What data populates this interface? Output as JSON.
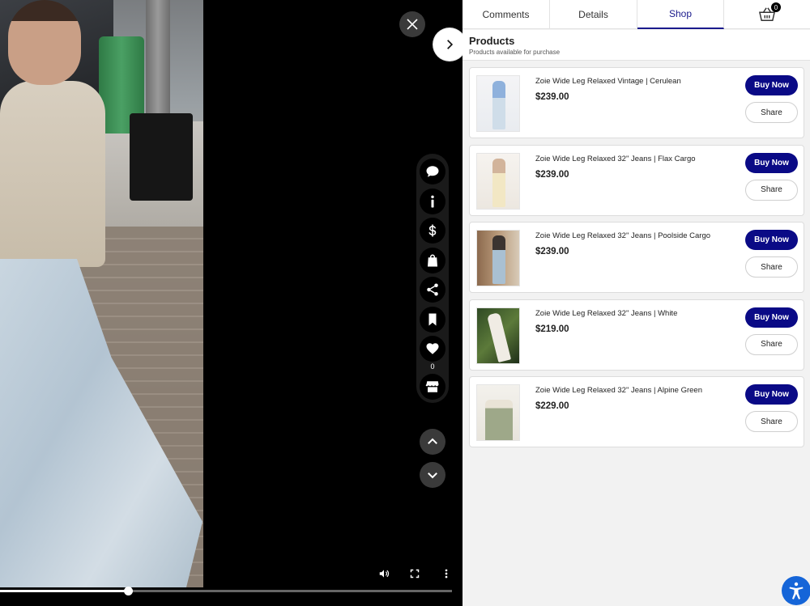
{
  "tabs": [
    {
      "label": "Comments"
    },
    {
      "label": "Details"
    },
    {
      "label": "Shop"
    }
  ],
  "cart": {
    "count": "0"
  },
  "products_header": {
    "title": "Products",
    "subtitle": "Products available for purchase"
  },
  "products": [
    {
      "name": "Zoie Wide Leg Relaxed Vintage | Cerulean",
      "price": "$239.00",
      "buy_label": "Buy Now",
      "share_label": "Share"
    },
    {
      "name": "Zoie Wide Leg Relaxed 32\" Jeans | Flax Cargo",
      "price": "$239.00",
      "buy_label": "Buy Now",
      "share_label": "Share"
    },
    {
      "name": "Zoie Wide Leg Relaxed 32\" Jeans | Poolside Cargo",
      "price": "$239.00",
      "buy_label": "Buy Now",
      "share_label": "Share"
    },
    {
      "name": "Zoie Wide Leg Relaxed 32\" Jeans | White",
      "price": "$219.00",
      "buy_label": "Buy Now",
      "share_label": "Share"
    },
    {
      "name": "Zoie Wide Leg Relaxed 32\" Jeans | Alpine Green",
      "price": "$229.00",
      "buy_label": "Buy Now",
      "share_label": "Share"
    }
  ],
  "video": {
    "like_count": "0",
    "progress_fraction": 0.283,
    "side_actions": [
      "comment-icon",
      "info-icon",
      "dollar-icon",
      "shopping-bag-icon",
      "share-icon",
      "bookmark-icon",
      "heart-icon",
      "store-icon"
    ]
  },
  "colors": {
    "accent": "#0a0a86",
    "panel_bg": "#f2f2f2",
    "accessibility": "#1565d8"
  }
}
